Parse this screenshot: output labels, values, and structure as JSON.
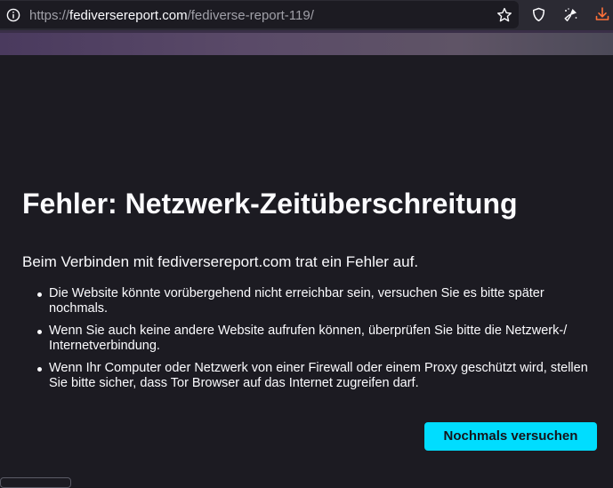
{
  "browser": {
    "url_scheme": "https://",
    "url_host": "fediversereport.com",
    "url_path": "/fediverse-report-119/",
    "icons": {
      "site_info": "info-icon",
      "bookmark": "star-icon",
      "tracking_protection": "shield-icon",
      "clear_data": "brush-icon",
      "downloads": "download-icon"
    },
    "colors": {
      "toolbar": "#2b2a33",
      "urlbar": "#1c1b22",
      "download_accent": "#ff7139"
    }
  },
  "error_page": {
    "title": "Fehler: Netzwerk-Zeitüberschreitung",
    "intro": "Beim Verbinden mit fediversereport.com trat ein Fehler auf.",
    "suggestions": [
      "Die Website könnte vorübergehend nicht erreichbar sein, versuchen Sie es bitte später nochmals.",
      "Wenn Sie auch keine andere Website aufrufen können, überprüfen Sie bitte die Netzwerk-/ Internetverbindung.",
      "Wenn Ihr Computer oder Netzwerk von einer Firewall oder einem Proxy geschützt wird, stellen Sie bitte sicher, dass Tor Browser auf das Internet zugreifen darf."
    ],
    "retry_label": "Nochmals versuchen",
    "colors": {
      "background": "#1c1b22",
      "text": "#fbfbfe",
      "button": "#00ddff"
    }
  }
}
